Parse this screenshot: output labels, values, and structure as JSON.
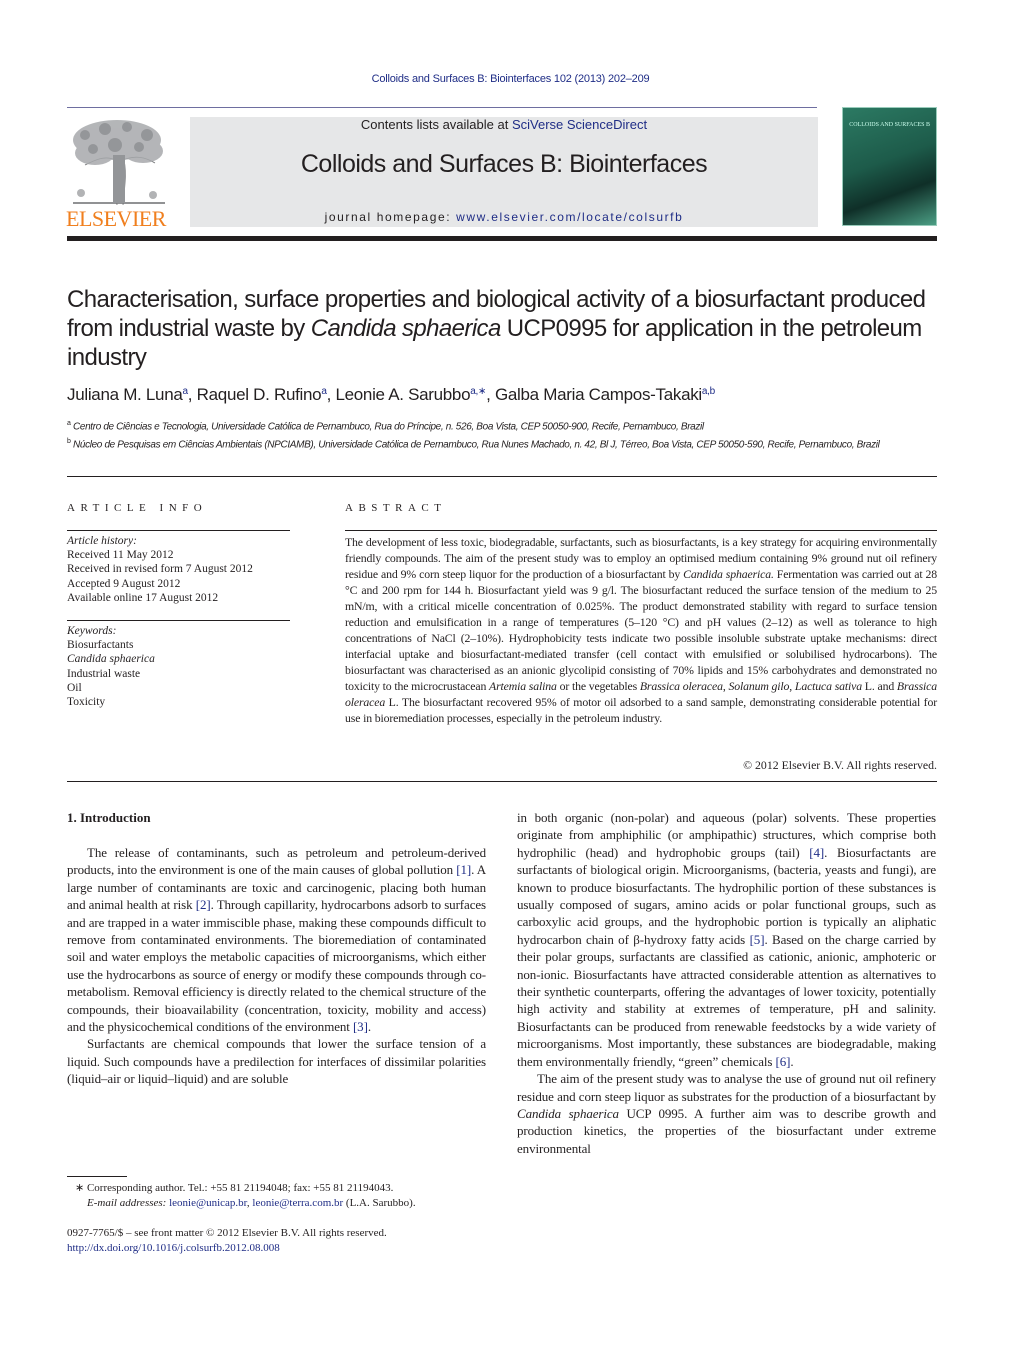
{
  "header": {
    "running_head": "Colloids and Surfaces B: Biointerfaces 102 (2013) 202–209",
    "contents_prefix": "Contents lists available at ",
    "contents_link": "SciVerse ScienceDirect",
    "journal_title": "Colloids and Surfaces B: Biointerfaces",
    "homepage_prefix": "journal homepage: ",
    "homepage_link": "www.elsevier.com/locate/colsurfb",
    "publisher_logo_text": "ELSEVIER",
    "cover_title": "COLLOIDS AND SURFACES B",
    "colors": {
      "link": "#1f2d86",
      "elsevier_orange": "#f07f1e",
      "banner_bg": "#e6e7e8"
    }
  },
  "article": {
    "title_part1": "Characterisation, surface properties and biological activity of a biosurfactant produced from industrial waste by ",
    "title_italic": "Candida sphaerica",
    "title_part2": " UCP0995 for application in the petroleum industry",
    "authors": [
      {
        "name": "Juliana M. Luna",
        "sup": "a"
      },
      {
        "name": "Raquel D. Rufino",
        "sup": "a"
      },
      {
        "name": "Leonie A. Sarubbo",
        "sup": "a,∗"
      },
      {
        "name": "Galba Maria Campos-Takaki",
        "sup": "a,b"
      }
    ],
    "affiliations": [
      {
        "label": "a",
        "text": "Centro de Ciências e Tecnologia, Universidade Católica de Pernambuco, Rua do Príncipe, n. 526, Boa Vista, CEP 50050-900, Recife, Pernambuco, Brazil"
      },
      {
        "label": "b",
        "text": "Núcleo de Pesquisas em Ciências Ambientais (NPCIAMB), Universidade Católica de Pernambuco, Rua Nunes Machado, n. 42, Bl J, Térreo, Boa Vista, CEP 50050-590, Recife, Pernambuco, Brazil"
      }
    ]
  },
  "article_info": {
    "heading": "ARTICLE INFO",
    "history_label": "Article history:",
    "history": [
      "Received 11 May 2012",
      "Received in revised form 7 August 2012",
      "Accepted 9 August 2012",
      "Available online 17 August 2012"
    ],
    "keywords_label": "Keywords:",
    "keywords": [
      "Biosurfactants",
      "Candida sphaerica",
      "Industrial waste",
      "Oil",
      "Toxicity"
    ]
  },
  "abstract": {
    "heading": "ABSTRACT",
    "s1": "The development of less toxic, biodegradable, surfactants, such as biosurfactants, is a key strategy for acquiring environmentally friendly compounds. The aim of the present study was to employ an optimised medium containing 9% ground nut oil refinery residue and 9% corn steep liquor for the production of a biosurfactant by ",
    "s1_italic": "Candida sphaerica.",
    "s2": " Fermentation was carried out at 28 °C and 200 rpm for 144 h. Biosurfactant yield was 9 g/l. The biosurfactant reduced the surface tension of the medium to 25 mN/m, with a critical micelle concentration of 0.025%. The product demonstrated stability with regard to surface tension reduction and emulsification in a range of temperatures (5–120 °C) and pH values (2–12) as well as tolerance to high concentrations of NaCl (2–10%). Hydrophobicity tests indicate two possible insoluble substrate uptake mechanisms: direct interfacial uptake and biosurfactant-mediated transfer (cell contact with emulsified or solubilised hydrocarbons). The biosurfactant was characterised as an anionic glycolipid consisting of 70% lipids and 15% carbohydrates and demonstrated no toxicity to the microcrustacean ",
    "i1": "Artemia salina",
    "t1": " or the vegetables ",
    "i2": "Brassica oleracea",
    "t2": ", ",
    "i3": "Solanum gilo",
    "t3": ", ",
    "i4": "Lactuca sativa",
    "t4": " L. and ",
    "i5": "Brassica oleracea",
    "t5": " L. The biosurfactant recovered 95% of motor oil adsorbed to a sand sample, demonstrating considerable potential for use in bioremediation processes, especially in the petroleum industry.",
    "copyright": "© 2012 Elsevier B.V. All rights reserved."
  },
  "introduction": {
    "heading": "1.  Introduction",
    "p1_a": "The release of contaminants, such as petroleum and petroleum-derived products, into the environment is one of the main causes of global pollution ",
    "ref1": "[1]",
    "p1_b": ". A large number of contaminants are toxic and carcinogenic, placing both human and animal health at risk ",
    "ref2": "[2]",
    "p1_c": ". Through capillarity, hydrocarbons adsorb to surfaces and are trapped in a water immiscible phase, making these compounds difficult to remove from contaminated environments. The bioremediation of contaminated soil and water employs the metabolic capacities of microorganisms, which either use the hydrocarbons as source of energy or modify these compounds through co-metabolism. Removal efficiency is directly related to the chemical structure of the compounds, their bioavailability (concentration, toxicity, mobility and access) and the physicochemical conditions of the environment ",
    "ref3": "[3]",
    "p1_d": ".",
    "p2_a": "Surfactants are chemical compounds that lower the surface tension of a liquid. Such compounds have a predilection for interfaces of dissimilar polarities (liquid–air or liquid–liquid) and are soluble",
    "p2_b": "in both organic (non-polar) and aqueous (polar) solvents. These properties originate from amphiphilic (or amphipathic) structures, which comprise both hydrophilic (head) and hydrophobic groups (tail) ",
    "ref4": "[4]",
    "p2_c": ". Biosurfactants are surfactants of biological origin. Microorganisms, (bacteria, yeasts and fungi), are known to produce biosurfactants. The hydrophilic portion of these substances is usually composed of sugars, amino acids or polar functional groups, such as carboxylic acid groups, and the hydrophobic portion is typically an aliphatic hydrocarbon chain of β-hydroxy fatty acids ",
    "ref5": "[5]",
    "p2_d": ". Based on the charge carried by their polar groups, surfactants are classified as cationic, anionic, amphoteric or non-ionic. Biosurfactants have attracted considerable attention as alternatives to their synthetic counterparts, offering the advantages of lower toxicity, potentially high activity and stability at extremes of temperature, pH and salinity. Biosurfactants can be produced from renewable feedstocks by a wide variety of microorganisms. Most importantly, these substances are biodegradable, making them environmentally friendly, “green” chemicals ",
    "ref6": "[6]",
    "p2_e": ".",
    "p3_a": "The aim of the present study was to analyse the use of ground nut oil refinery residue and corn steep liquor as substrates for the production of a biosurfactant by ",
    "p3_italic": "Candida sphaerica",
    "p3_b": " UCP 0995. A further aim was to describe growth and production kinetics, the properties of the biosurfactant under extreme environmental"
  },
  "footnote": {
    "star": "∗",
    "corresponding": " Corresponding author. Tel.: +55 81 21194048; fax: +55 81 21194043.",
    "email_label": "E-mail addresses: ",
    "email1": "leonie@unicap.br",
    "sep": ", ",
    "email2": "leonie@terra.com.br",
    "email_suffix": " (L.A. Sarubbo).",
    "front_matter": "0927-7765/$ – see front matter © 2012 Elsevier B.V. All rights reserved.",
    "doi": "http://dx.doi.org/10.1016/j.colsurfb.2012.08.008"
  }
}
